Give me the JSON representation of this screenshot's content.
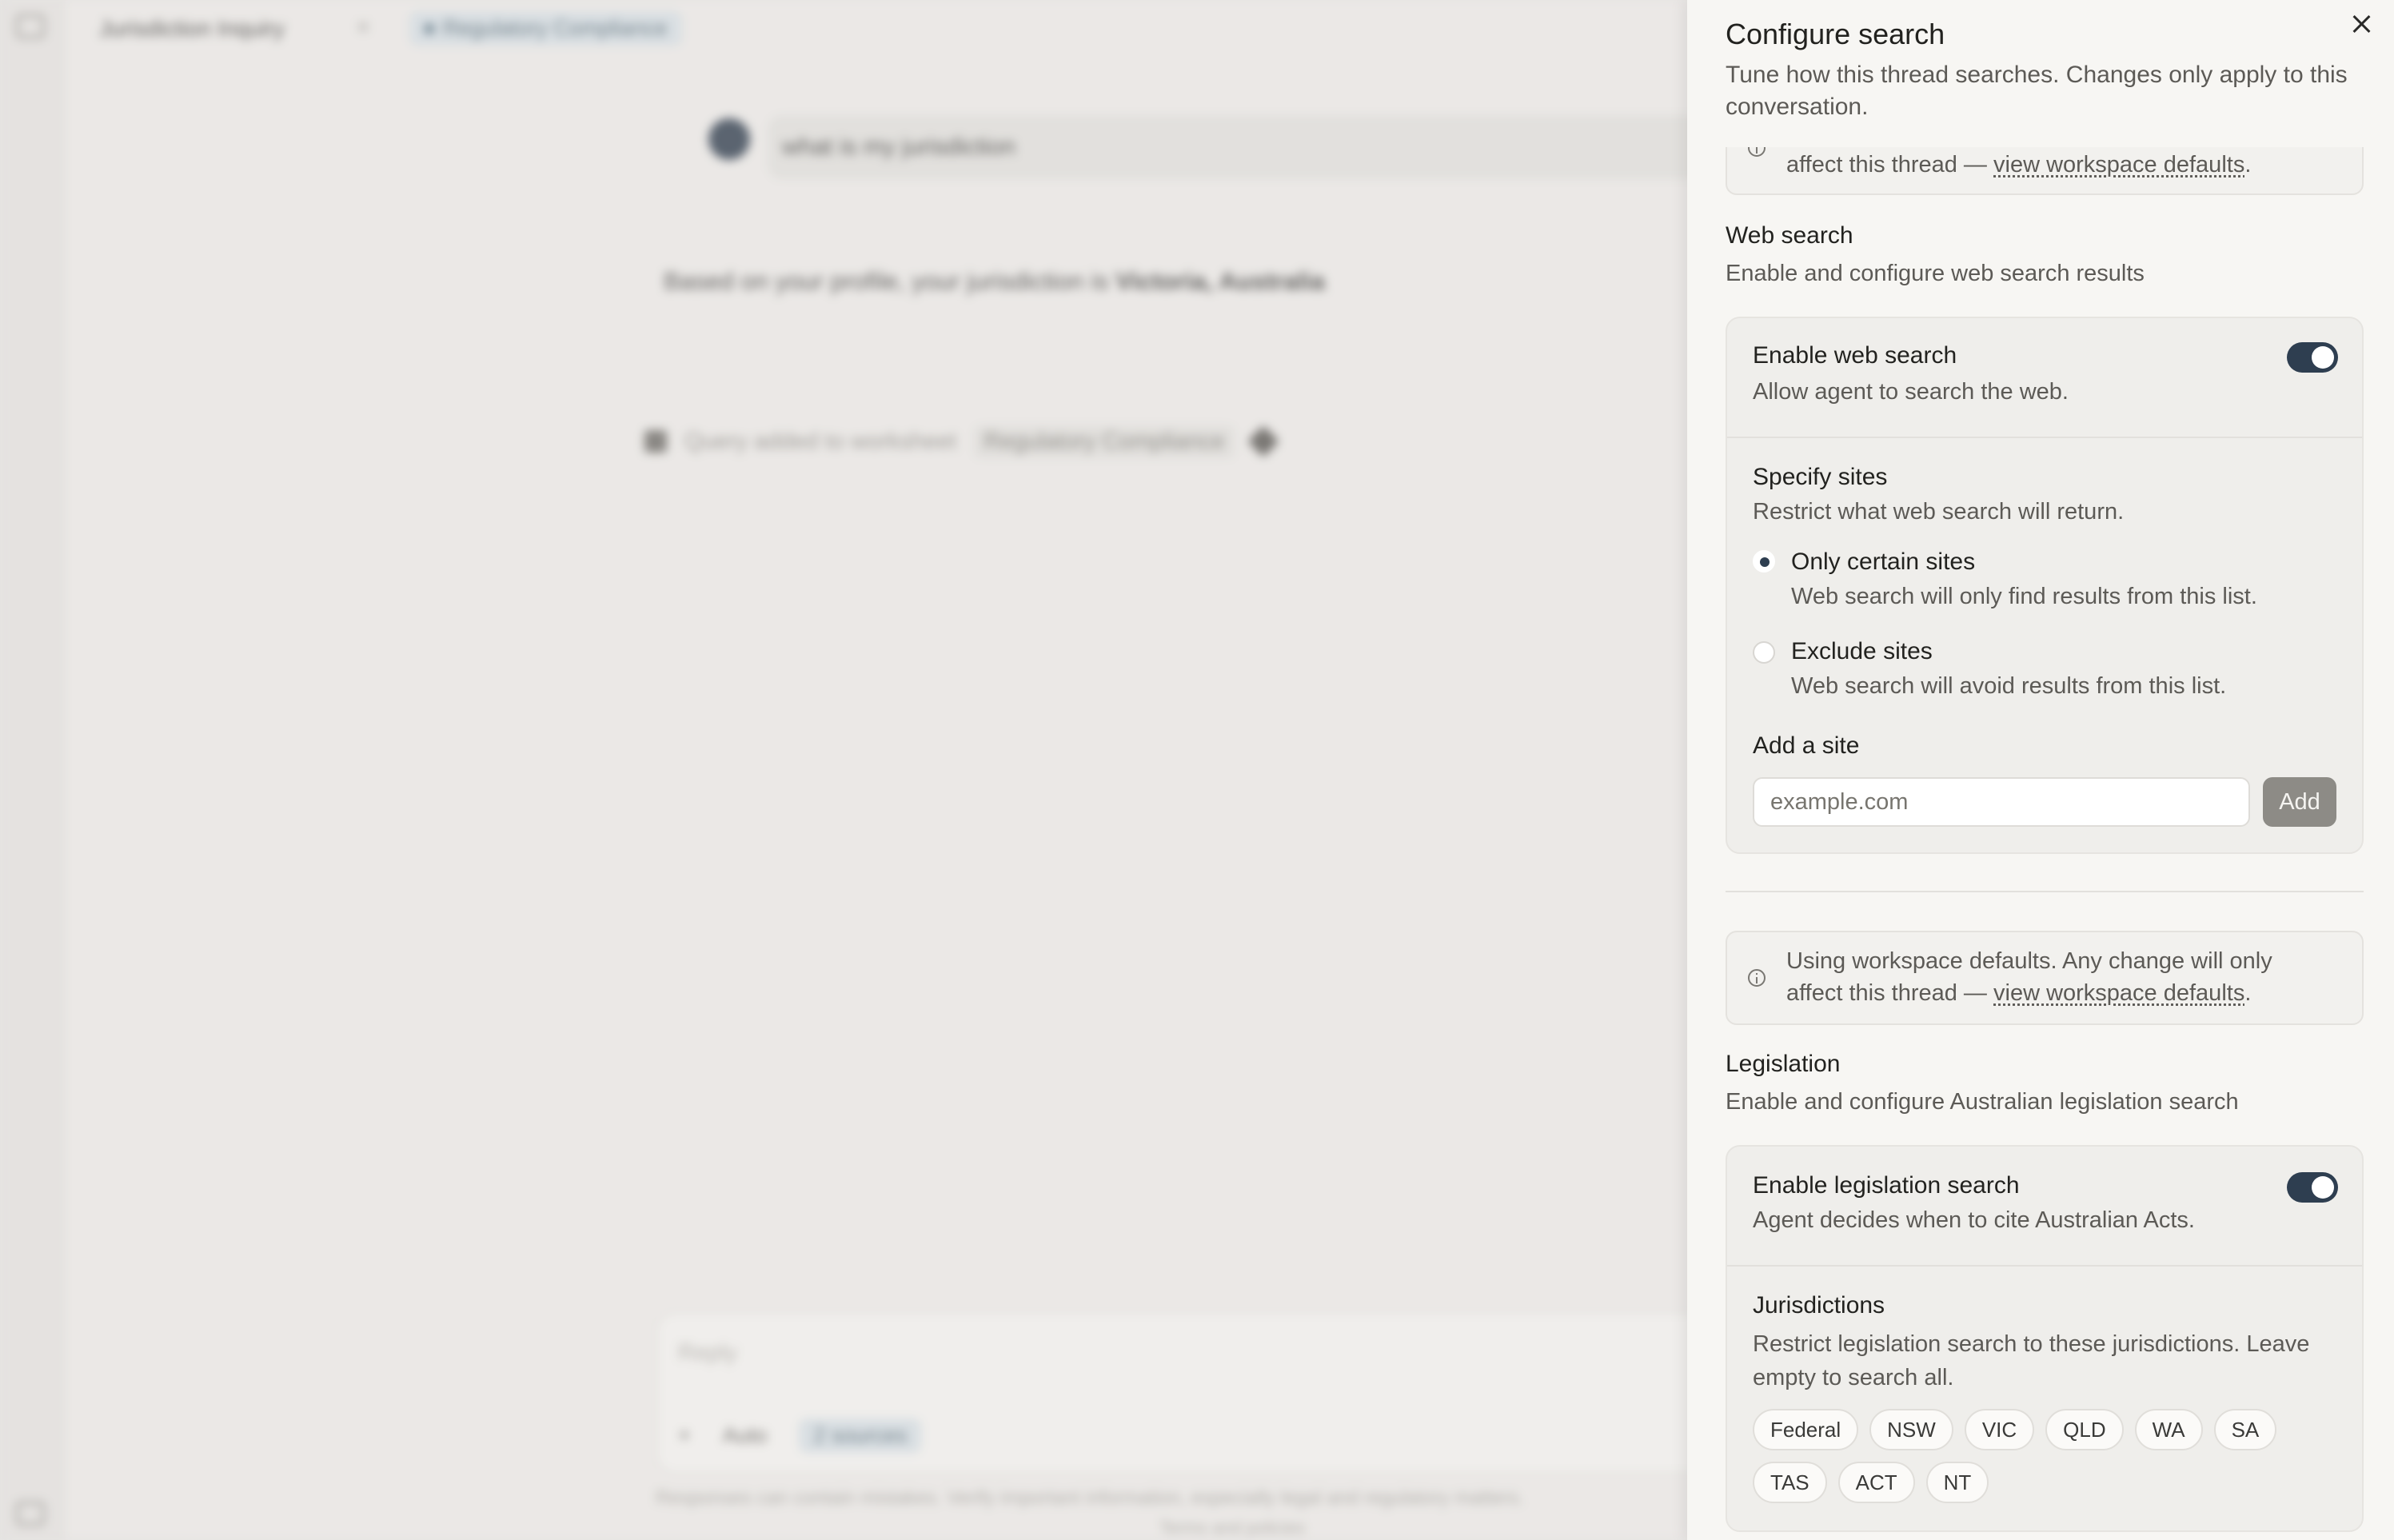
{
  "background": {
    "thread_title": "Jurisdiction Inquiry",
    "tag": "Regulatory Compliance",
    "user_message": "what is my jurisdiction",
    "answer_prefix": "Based on your profile, your jurisdiction is",
    "answer_bold": "Victoria, Australia",
    "query_note": "Query added to worksheet",
    "query_chip": "Regulatory Compliance",
    "composer_placeholder": "Reply",
    "mode_label": "Auto",
    "channel_chip": "2 sources",
    "disclaimer": "Responses can contain mistakes. Verify important information, especially legal and regulatory matters.",
    "footer": "Terms and policies"
  },
  "panel": {
    "title": "Configure search",
    "subtitle": "Tune how this thread searches. Changes only apply to this conversation.",
    "close_icon": "close-icon"
  },
  "info_top": {
    "text_prefix": "affect this thread —",
    "link": "view workspace defaults",
    "text_suffix": "."
  },
  "web_search": {
    "title": "Web search",
    "description": "Enable and configure web search results",
    "enable_title": "Enable web search",
    "enable_desc": "Allow agent to search the web.",
    "enabled": true,
    "specify_title": "Specify sites",
    "specify_desc": "Restrict what web search will return.",
    "mode_selected": "only",
    "option_only_label": "Only certain sites",
    "option_only_desc": "Web search will only find results from this list.",
    "option_exclude_label": "Exclude sites",
    "option_exclude_desc": "Web search will avoid results from this list.",
    "add_site_label": "Add a site",
    "add_site_placeholder": "example.com",
    "add_button": "Add"
  },
  "info_bottom": {
    "text_line1": "Using workspace defaults. Any change will only",
    "text_prefix": "affect this thread —",
    "link": "view workspace defaults",
    "text_suffix": "."
  },
  "legislation": {
    "title": "Legislation",
    "description": "Enable and configure Australian legislation search",
    "enable_title": "Enable legislation search",
    "enable_desc": "Agent decides when to cite Australian Acts.",
    "enabled": true,
    "jurisdictions_title": "Jurisdictions",
    "jurisdictions_desc": "Restrict legislation search to these jurisdictions. Leave empty to search all.",
    "jurisdictions": [
      "Federal",
      "NSW",
      "VIC",
      "QLD",
      "WA",
      "SA",
      "TAS",
      "ACT",
      "NT"
    ]
  },
  "colors": {
    "toggle_on": "#2e3e50",
    "panel_bg": "#f7f6f3",
    "card_bg": "#efeeeb"
  }
}
